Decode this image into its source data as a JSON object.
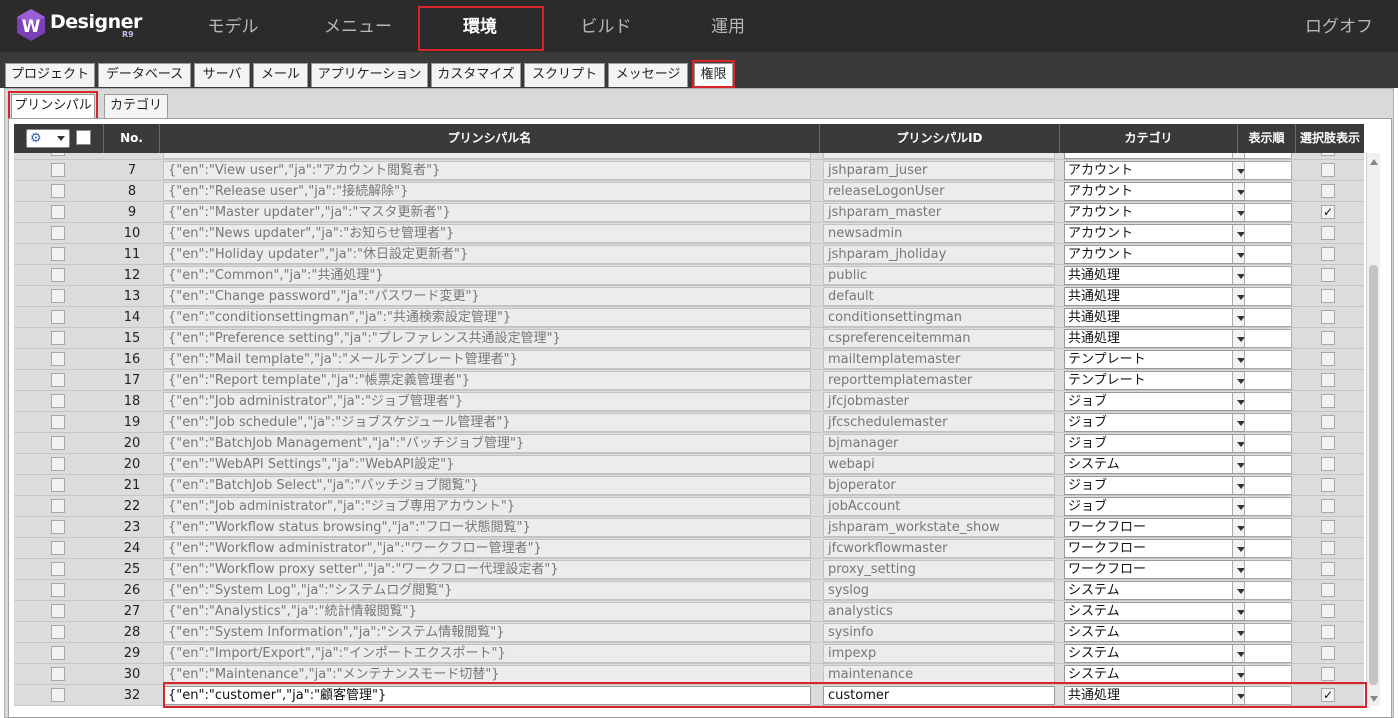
{
  "app": {
    "logo_text": "Designer",
    "logo_sub": "R9",
    "logo_letter": "W"
  },
  "nav": {
    "items": [
      {
        "label": "モデル"
      },
      {
        "label": "メニュー"
      },
      {
        "label": "環境"
      },
      {
        "label": "ビルド"
      },
      {
        "label": "運用"
      }
    ],
    "active": "環境",
    "logout": "ログオフ"
  },
  "tabs1": [
    "プロジェクト",
    "データベース",
    "サーバ",
    "メール",
    "アプリケーション",
    "カスタマイズ",
    "スクリプト",
    "メッセージ",
    "権限"
  ],
  "tabs1_active": "権限",
  "tabs2": [
    "プリンシパル",
    "カテゴリ"
  ],
  "tabs2_active": "プリンシパル",
  "grid": {
    "columns": {
      "no": "No.",
      "name": "プリンシパル名",
      "id": "プリンシパルID",
      "category": "カテゴリ",
      "order": "表示順",
      "show": "選択肢表示"
    },
    "rows": [
      {
        "no": "7",
        "name": "{\"en\":\"View user\",\"ja\":\"アカウント閲覧者\"}",
        "id": "jshparam_juser",
        "category": "アカウント",
        "show": false
      },
      {
        "no": "8",
        "name": "{\"en\":\"Release user\",\"ja\":\"接続解除\"}",
        "id": "releaseLogonUser",
        "category": "アカウント",
        "show": false
      },
      {
        "no": "9",
        "name": "{\"en\":\"Master updater\",\"ja\":\"マスタ更新者\"}",
        "id": "jshparam_master",
        "category": "アカウント",
        "show": true
      },
      {
        "no": "10",
        "name": "{\"en\":\"News updater\",\"ja\":\"お知らせ管理者\"}",
        "id": "newsadmin",
        "category": "アカウント",
        "show": false
      },
      {
        "no": "11",
        "name": "{\"en\":\"Holiday updater\",\"ja\":\"休日設定更新者\"}",
        "id": "jshparam_jholiday",
        "category": "アカウント",
        "show": false
      },
      {
        "no": "12",
        "name": "{\"en\":\"Common\",\"ja\":\"共通処理\"}",
        "id": "public",
        "category": "共通処理",
        "show": false
      },
      {
        "no": "13",
        "name": "{\"en\":\"Change password\",\"ja\":\"パスワード変更\"}",
        "id": "default",
        "category": "共通処理",
        "show": false
      },
      {
        "no": "14",
        "name": "{\"en\":\"conditionsettingman\",\"ja\":\"共通検索設定管理\"}",
        "id": "conditionsettingman",
        "category": "共通処理",
        "show": false
      },
      {
        "no": "15",
        "name": "{\"en\":\"Preference setting\",\"ja\":\"プレファレンス共通設定管理\"}",
        "id": "cspreferenceitemman",
        "category": "共通処理",
        "show": false
      },
      {
        "no": "16",
        "name": "{\"en\":\"Mail template\",\"ja\":\"メールテンプレート管理者\"}",
        "id": "mailtemplatemaster",
        "category": "テンプレート",
        "show": false
      },
      {
        "no": "17",
        "name": "{\"en\":\"Report template\",\"ja\":\"帳票定義管理者\"}",
        "id": "reporttemplatemaster",
        "category": "テンプレート",
        "show": false
      },
      {
        "no": "18",
        "name": "{\"en\":\"Job administrator\",\"ja\":\"ジョブ管理者\"}",
        "id": "jfcjobmaster",
        "category": "ジョブ",
        "show": false
      },
      {
        "no": "19",
        "name": "{\"en\":\"Job schedule\",\"ja\":\"ジョブスケジュール管理者\"}",
        "id": "jfcschedulemaster",
        "category": "ジョブ",
        "show": false
      },
      {
        "no": "20",
        "name": "{\"en\":\"BatchJob Management\",\"ja\":\"バッチジョブ管理\"}",
        "id": "bjmanager",
        "category": "ジョブ",
        "show": false
      },
      {
        "no": "20",
        "name": "{\"en\":\"WebAPI Settings\",\"ja\":\"WebAPI設定\"}",
        "id": "webapi",
        "category": "システム",
        "show": false
      },
      {
        "no": "21",
        "name": "{\"en\":\"BatchJob Select\",\"ja\":\"バッチジョブ閲覧\"}",
        "id": "bjoperator",
        "category": "ジョブ",
        "show": false
      },
      {
        "no": "22",
        "name": "{\"en\":\"Job administrator\",\"ja\":\"ジョブ専用アカウント\"}",
        "id": "jobAccount",
        "category": "ジョブ",
        "show": false
      },
      {
        "no": "23",
        "name": "{\"en\":\"Workflow status browsing\",\"ja\":\"フロー状態閲覧\"}",
        "id": "jshparam_workstate_show",
        "category": "ワークフロー",
        "show": false
      },
      {
        "no": "24",
        "name": "{\"en\":\"Workflow administrator\",\"ja\":\"ワークフロー管理者\"}",
        "id": "jfcworkflowmaster",
        "category": "ワークフロー",
        "show": false
      },
      {
        "no": "25",
        "name": "{\"en\":\"Workflow proxy setter\",\"ja\":\"ワークフロー代理設定者\"}",
        "id": "proxy_setting",
        "category": "ワークフロー",
        "show": false
      },
      {
        "no": "26",
        "name": "{\"en\":\"System Log\",\"ja\":\"システムログ閲覧\"}",
        "id": "syslog",
        "category": "システム",
        "show": false
      },
      {
        "no": "27",
        "name": "{\"en\":\"Analystics\",\"ja\":\"統計情報閲覧\"}",
        "id": "analystics",
        "category": "システム",
        "show": false
      },
      {
        "no": "28",
        "name": "{\"en\":\"System Information\",\"ja\":\"システム情報閲覧\"}",
        "id": "sysinfo",
        "category": "システム",
        "show": false
      },
      {
        "no": "29",
        "name": "{\"en\":\"Import/Export\",\"ja\":\"インポートエクスポート\"}",
        "id": "impexp",
        "category": "システム",
        "show": false
      },
      {
        "no": "30",
        "name": "{\"en\":\"Maintenance\",\"ja\":\"メンテナンスモード切替\"}",
        "id": "maintenance",
        "category": "システム",
        "show": false
      },
      {
        "no": "32",
        "name": "{\"en\":\"customer\",\"ja\":\"顧客管理\"}",
        "id": "customer",
        "category": "共通処理",
        "show": true,
        "editable": true
      }
    ]
  },
  "colors": {
    "header_bg": "#2b2b2b",
    "highlight": "#d8252b",
    "grid_header": "#3a3a3a",
    "row_bg": "#dcdcdc"
  },
  "icons": {
    "tool_button": "gear-icon",
    "dropdown": "chevron-down-icon"
  }
}
